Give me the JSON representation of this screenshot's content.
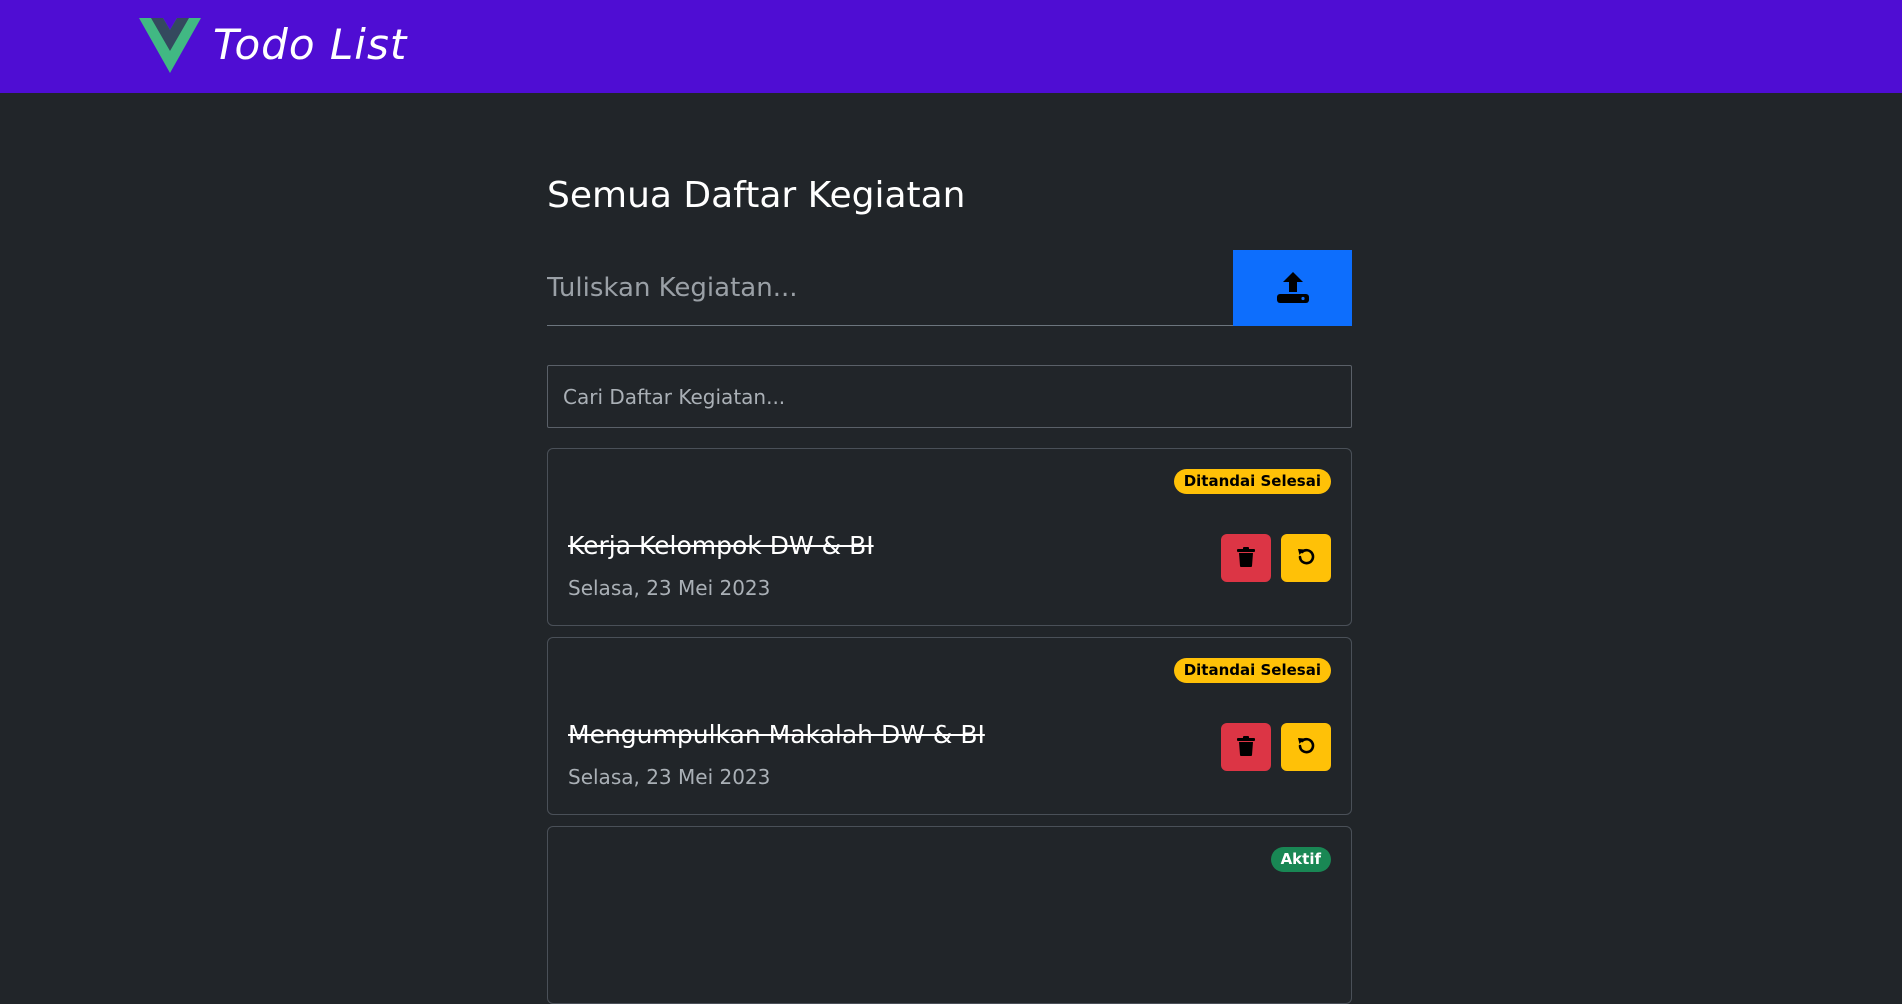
{
  "navbar": {
    "title": "Todo List",
    "logo_icon": "vue-logo-icon",
    "background": "#4f0dd3"
  },
  "main": {
    "heading": "Semua Daftar Kegiatan",
    "add_input_placeholder": "Tuliskan Kegiatan...",
    "add_button_icon": "upload-icon",
    "search_placeholder": "Cari Daftar Kegiatan..."
  },
  "todos": [
    {
      "title": "Kerja Kelompok DW & BI",
      "date": "Selasa, 23 Mei 2023",
      "status": "Ditandai Selesai",
      "completed": true,
      "status_color": "#ffc107"
    },
    {
      "title": "Mengumpulkan Makalah DW & BI",
      "date": "Selasa, 23 Mei 2023",
      "status": "Ditandai Selesai",
      "completed": true,
      "status_color": "#ffc107"
    },
    {
      "title": "",
      "date": "",
      "status": "Aktif",
      "completed": false,
      "status_color": "#198754"
    }
  ],
  "actions": {
    "delete_icon": "trash-icon",
    "restore_icon": "undo-icon",
    "delete_color": "#dc3545",
    "restore_color": "#ffc107"
  }
}
